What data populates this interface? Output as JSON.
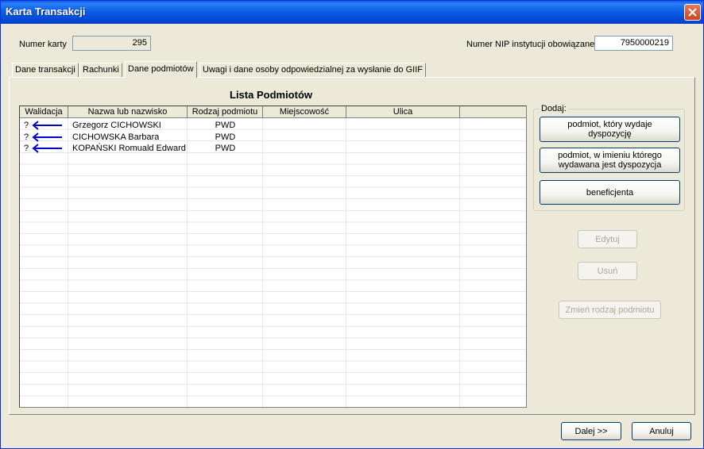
{
  "window": {
    "title": "Karta Transakcji"
  },
  "header": {
    "card_number_label": "Numer karty",
    "card_number_value": "295",
    "nip_label": "Numer NIP instytucji obowiązanej",
    "nip_value": "7950000219"
  },
  "tabs": [
    {
      "label": "Dane transakcji",
      "active": false
    },
    {
      "label": "Rachunki",
      "active": false
    },
    {
      "label": "Dane podmiotów",
      "active": true
    },
    {
      "label": "Uwagi i dane osoby odpowiedzialnej za wysłanie do GIIF",
      "active": false
    }
  ],
  "list": {
    "title": "Lista Podmiotów",
    "columns": [
      "Walidacja",
      "Nazwa lub nazwisko",
      "Rodzaj podmiotu",
      "Miejscowość",
      "Ulica"
    ],
    "rows": [
      {
        "validation": "?",
        "name": " Grzegorz CICHOWSKI",
        "type": "PWD",
        "city": "",
        "street": ""
      },
      {
        "validation": "?",
        "name": "CICHOWSKA Barbara",
        "type": "PWD",
        "city": "",
        "street": ""
      },
      {
        "validation": "?",
        "name": "KOPAŃSKI Romuald Edward",
        "type": "PWD",
        "city": "",
        "street": ""
      }
    ]
  },
  "add_group": {
    "legend": "Dodaj:",
    "btn_issuer_line1": "podmiot, który wydaje",
    "btn_issuer_line2": "dyspozycję",
    "btn_on_behalf_line1": "podmiot, w imieniu którego",
    "btn_on_behalf_line2": "wydawana jest dyspozycja",
    "btn_beneficiary": "beneficjenta"
  },
  "actions": {
    "edit": "Edytuj",
    "delete": "Usuń",
    "change_type": "Zmień rodzaj podmiotu"
  },
  "footer": {
    "next": "Dalej >>",
    "cancel": "Anuluj"
  },
  "colors": {
    "titlebar": "#0054e3",
    "arrow": "#0000cc",
    "face": "#ece9d8"
  },
  "icons": {
    "close": "close-icon",
    "arrow": "arrow-left-icon"
  }
}
